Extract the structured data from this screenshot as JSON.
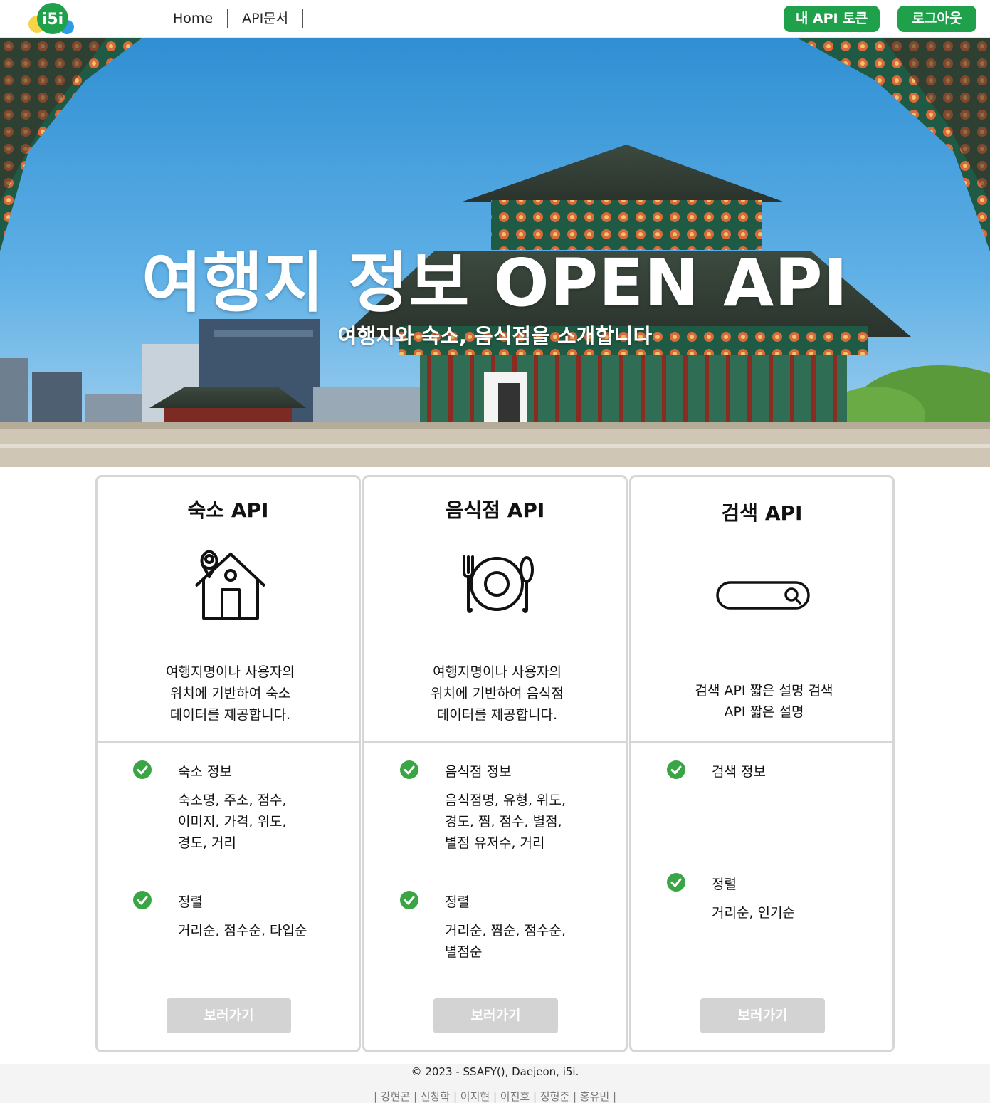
{
  "header": {
    "logo_text": "i5i",
    "nav": [
      {
        "label": "Home"
      },
      {
        "label": "API문서"
      }
    ],
    "token_button": "내 API 토큰",
    "logout_button": "로그아웃",
    "accent_color": "#1fa04a"
  },
  "hero": {
    "title": "여행지 정보 OPEN API",
    "subtitle": "여행지와 숙소, 음식점을 소개합니다"
  },
  "cards": [
    {
      "title": "숙소 API",
      "icon": "house-location-icon",
      "description": [
        "여행지명이나 사용자의",
        "위치에 기반하여 숙소",
        "데이터를 제공합니다."
      ],
      "features": [
        {
          "title": "숙소 정보",
          "lines": [
            "숙소명, 주소, 점수,",
            "이미지, 가격, 위도,",
            "경도, 거리"
          ]
        },
        {
          "title": "정렬",
          "lines": [
            "거리순, 점수순, 타입순"
          ]
        }
      ],
      "button": "보러가기"
    },
    {
      "title": "음식점 API",
      "icon": "plate-cutlery-icon",
      "description": [
        "여행지명이나 사용자의",
        "위치에 기반하여 음식점",
        "데이터를 제공합니다."
      ],
      "features": [
        {
          "title": "음식점 정보",
          "lines": [
            "음식점명, 유형, 위도,",
            "경도, 찜, 점수, 별점,",
            "별점 유저수, 거리"
          ]
        },
        {
          "title": "정렬",
          "lines": [
            "거리순, 찜순, 점수순,",
            "별점순"
          ]
        }
      ],
      "button": "보러가기"
    },
    {
      "title": "검색 API",
      "icon": "search-bar-icon",
      "description": [
        "검색 API 짧은 설명 검색",
        "API 짧은 설명"
      ],
      "features": [
        {
          "title": "검색 정보",
          "lines": []
        },
        {
          "title": "정렬",
          "lines": [
            "거리순, 인기순"
          ]
        }
      ],
      "button": "보러가기"
    }
  ],
  "footer": {
    "copyright": "© 2023 - SSAFY(), Daejeon, i5i.",
    "members": "| 강현곤 | 신창학 | 이지현 | 이진호 | 정형준 | 홍유빈 |"
  },
  "colors": {
    "check_green": "#3aa544",
    "button_disabled": "#d3d3d3",
    "card_border": "#d6d6d6"
  }
}
